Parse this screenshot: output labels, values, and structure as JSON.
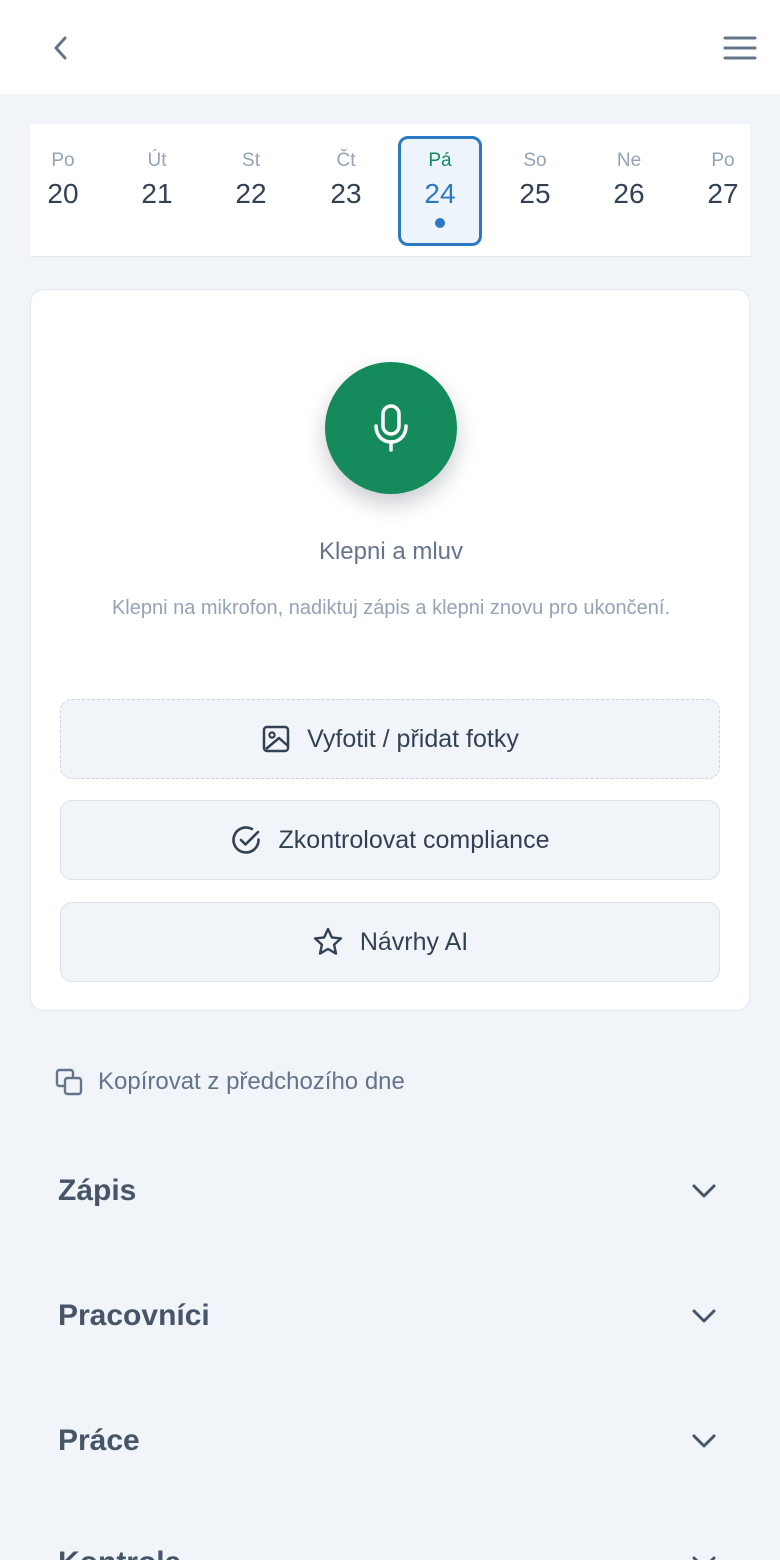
{
  "header": {
    "back_icon": "chevron-left-icon",
    "menu_icon": "hamburger-menu-icon"
  },
  "week": {
    "days": [
      {
        "name": "Po",
        "num": "20"
      },
      {
        "name": "Út",
        "num": "21"
      },
      {
        "name": "St",
        "num": "22"
      },
      {
        "name": "Čt",
        "num": "23"
      },
      {
        "name": "Pá",
        "num": "24"
      },
      {
        "name": "So",
        "num": "25"
      },
      {
        "name": "Ne",
        "num": "26"
      },
      {
        "name": "Po",
        "num": "27"
      }
    ],
    "selected_index": 4
  },
  "voice": {
    "title": "Klepni a mluv",
    "hint": "Klepni na mikrofon, nadiktuj zápis a klepni znovu pro ukončení.",
    "icon": "microphone-icon"
  },
  "actions": {
    "photos": "Vyfotit / přidat fotky",
    "compliance": "Zkontrolovat compliance",
    "ai": "Návrhy AI"
  },
  "copy_prev": "Kopírovat z předchozího dne",
  "sections": [
    "Zápis",
    "Pracovníci",
    "Práce",
    "Kontrola"
  ],
  "colors": {
    "accent_green": "#158a5c",
    "accent_blue": "#2b78c5",
    "background": "#f1f5f9"
  }
}
